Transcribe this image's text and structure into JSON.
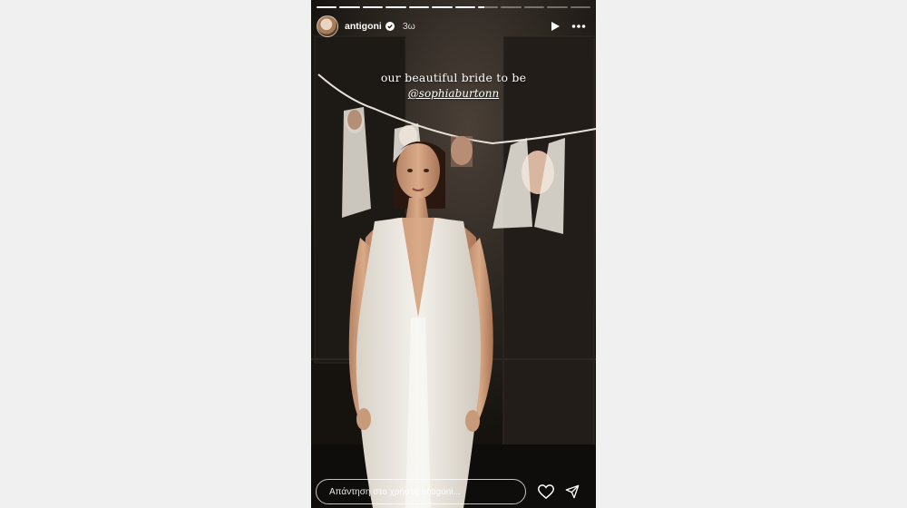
{
  "story": {
    "progress_segments": [
      1,
      1,
      1,
      1,
      1,
      1,
      1,
      0.3,
      0,
      0,
      0,
      0
    ],
    "user": {
      "name": "antigoni",
      "time": "3ω"
    },
    "caption": {
      "line1": "our beautiful bride to be",
      "mention": "@sophiaburtonn"
    },
    "reply": {
      "placeholder": "Απάντηση στο χρήστη antigoni..."
    },
    "icons": {
      "play": "play-icon",
      "more": "more-icon",
      "verified": "verified-badge-icon",
      "like": "heart-icon",
      "share": "send-icon"
    }
  }
}
